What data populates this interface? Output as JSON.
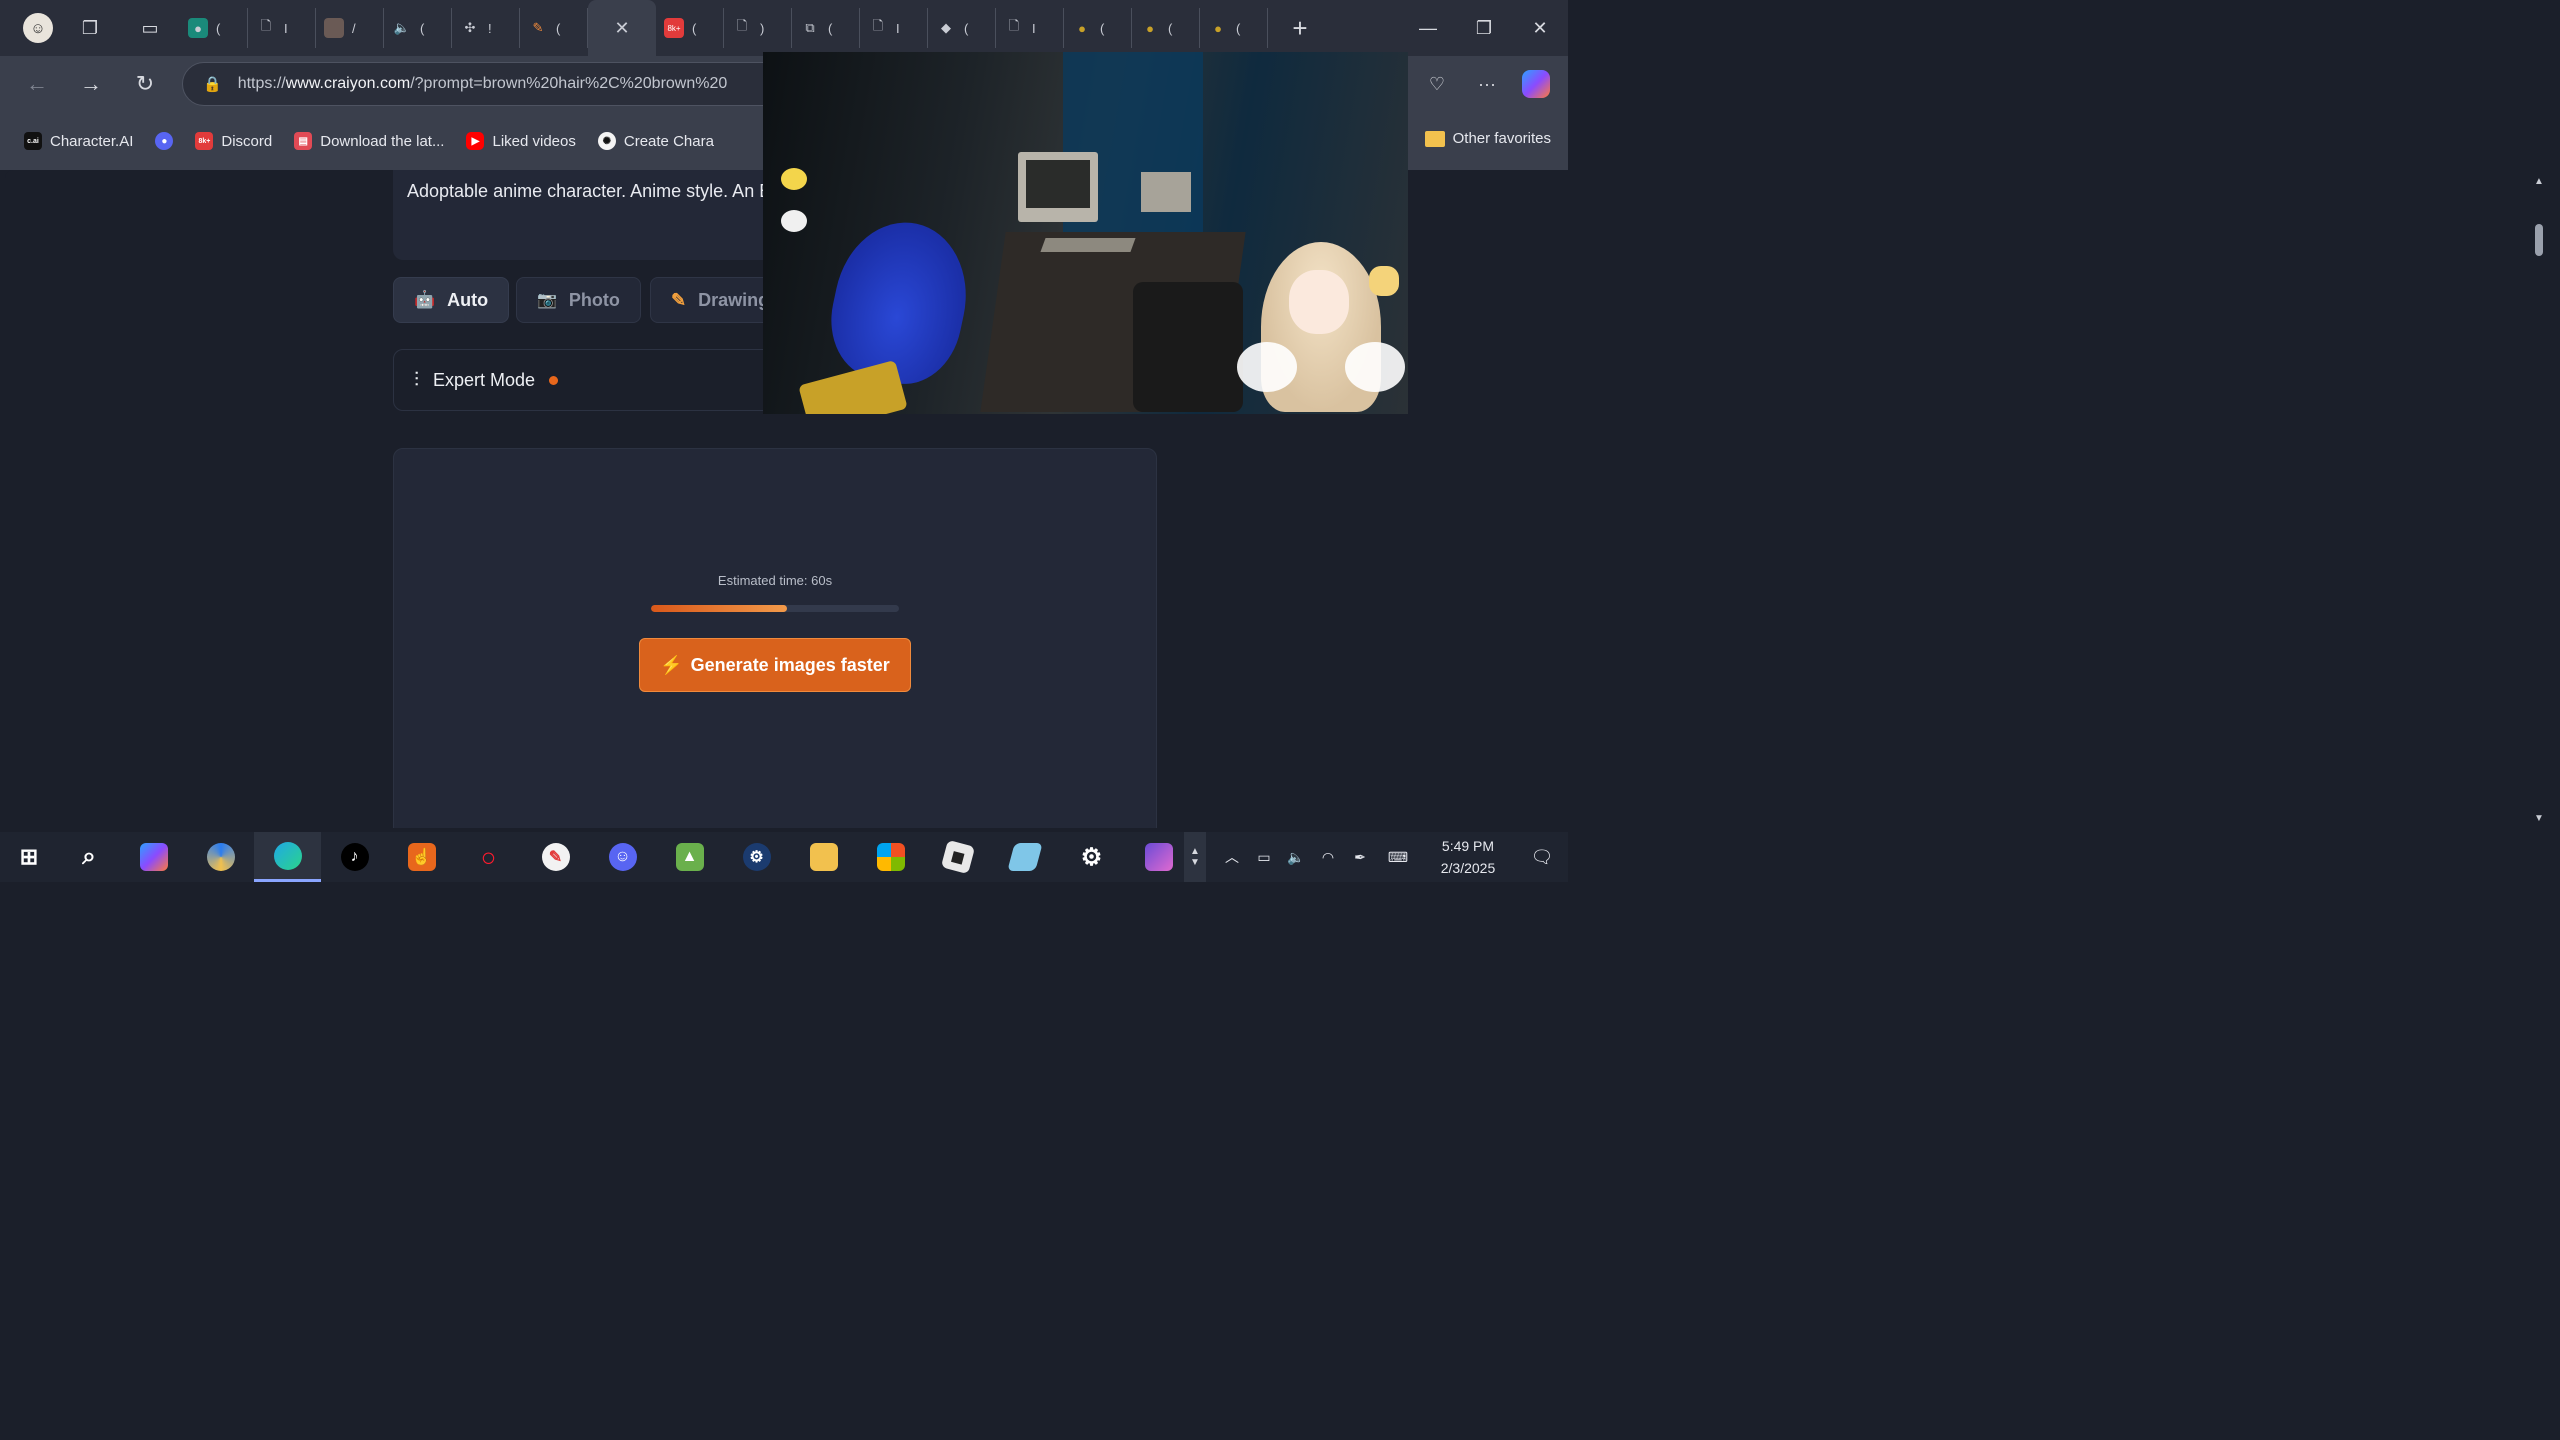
{
  "browser": {
    "address": {
      "url_prefix": "https://",
      "url_domain": "www.craiyon.com",
      "url_rest": "/?prompt=brown%20hair%2C%20brown%20"
    },
    "favorites": [
      {
        "label": "Character.AI",
        "icon": "c.ai"
      },
      {
        "label": "",
        "icon": "discord-icon"
      },
      {
        "label": "Discord",
        "icon": "8k+"
      },
      {
        "label": "Download the lat...",
        "icon": "itch-icon"
      },
      {
        "label": "Liked videos",
        "icon": "youtube-icon"
      },
      {
        "label": "Create Chara",
        "icon": "openai-icon"
      }
    ],
    "other_favorites": "Other favorites"
  },
  "page": {
    "prompt_text": "Adoptable anime character. Anime style. An Beloved. multi color hair. in anime style",
    "modes": [
      {
        "label": "Auto",
        "active": true
      },
      {
        "label": "Photo",
        "active": false
      },
      {
        "label": "Drawing",
        "active": false
      }
    ],
    "expert_mode": "Expert Mode",
    "estimated_time": "Estimated time: 60s",
    "progress_fraction": 0.55,
    "generate_button": "Generate images faster",
    "accent_color": "#d9621c"
  },
  "taskbar": {
    "time": "5:49 PM",
    "date": "2/3/2025"
  }
}
